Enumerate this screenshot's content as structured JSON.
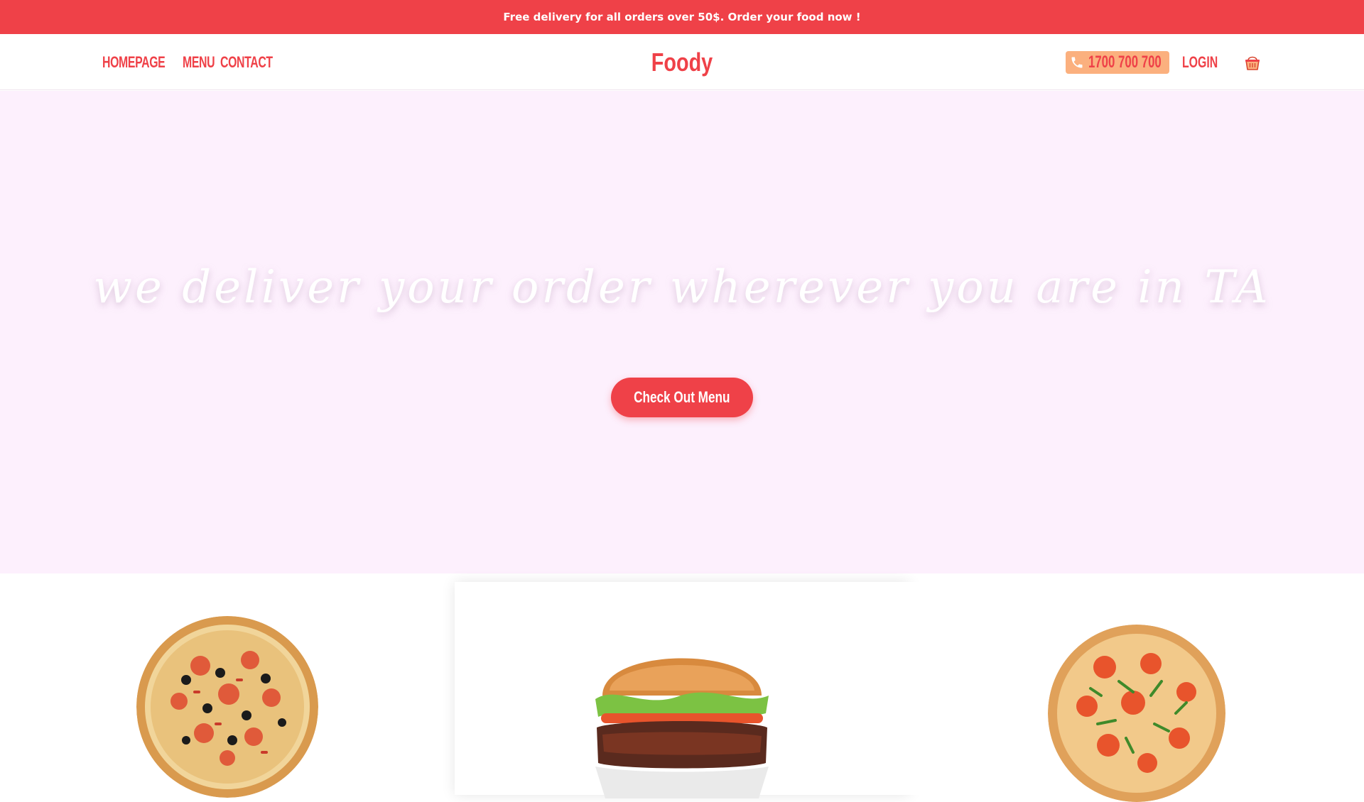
{
  "announcement": "Free delivery for all orders over 50$. Order your food now !",
  "nav": {
    "links": [
      "HOMEPAGE",
      "MENU",
      "CONTACT"
    ],
    "logo": "Foody",
    "phone": "1700 700 700",
    "login": "LOGIN"
  },
  "hero": {
    "title": "we deliver your order wherever you are in TA",
    "cta": "Check Out Menu"
  },
  "products": [
    {
      "name": "pizza-olive"
    },
    {
      "name": "burger"
    },
    {
      "name": "pizza-tomato-arugula"
    }
  ],
  "colors": {
    "accent": "#ef4148",
    "phone_bg": "#fbb07e",
    "hero_bg": "#fdf0fd"
  },
  "icons": [
    "phone-icon",
    "basket-icon"
  ]
}
